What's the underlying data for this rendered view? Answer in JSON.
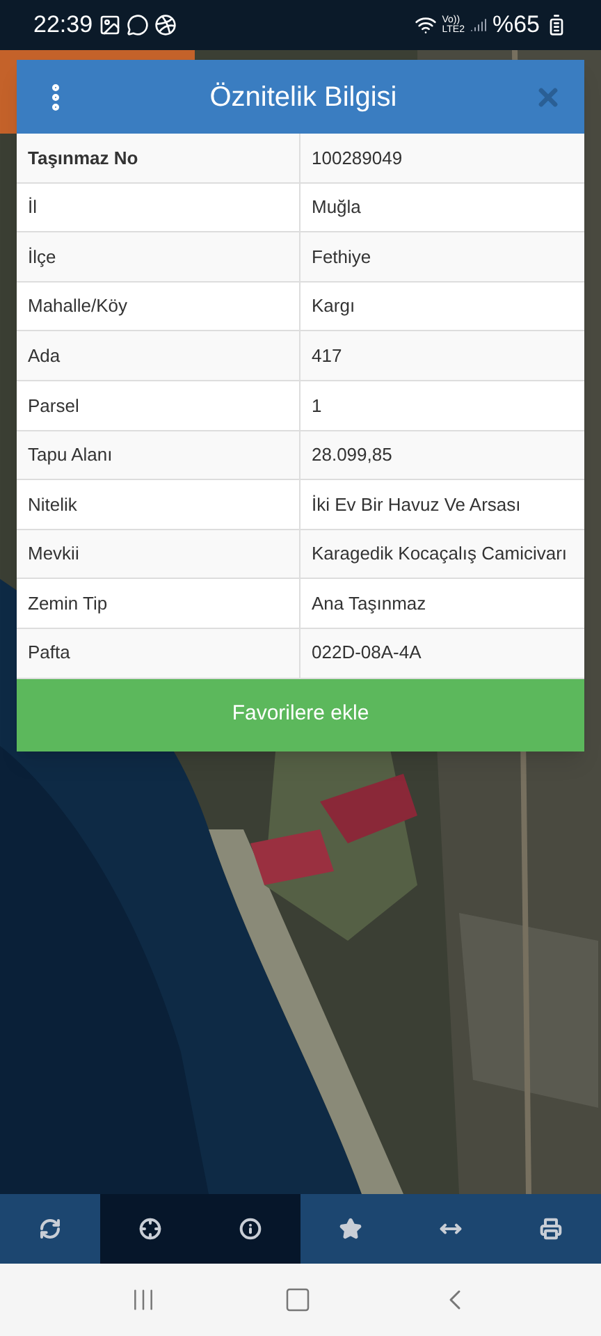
{
  "status_bar": {
    "time": "22:39",
    "network_top": "Vo))",
    "network_bottom": "LTE2",
    "battery": "%65"
  },
  "dialog": {
    "title": "Öznitelik Bilgisi",
    "rows": [
      {
        "label": "Taşınmaz No",
        "value": "100289049",
        "bold": true
      },
      {
        "label": "İl",
        "value": "Muğla",
        "bold": false
      },
      {
        "label": "İlçe",
        "value": "Fethiye",
        "bold": false
      },
      {
        "label": "Mahalle/Köy",
        "value": "Kargı",
        "bold": false
      },
      {
        "label": "Ada",
        "value": "417",
        "bold": false
      },
      {
        "label": "Parsel",
        "value": "1",
        "bold": false
      },
      {
        "label": "Tapu Alanı",
        "value": "28.099,85",
        "bold": false
      },
      {
        "label": "Nitelik",
        "value": "İki Ev Bir Havuz Ve Arsası",
        "bold": false
      },
      {
        "label": "Mevkii",
        "value": "Karagedik Kocaçalış Camicivarı",
        "bold": false
      },
      {
        "label": "Zemin Tip",
        "value": "Ana Taşınmaz",
        "bold": false
      },
      {
        "label": "Pafta",
        "value": "022D-08A-4A",
        "bold": false
      }
    ],
    "button": "Favorilere ekle"
  },
  "toolbar": [
    {
      "kind": "refresh",
      "selected": false
    },
    {
      "kind": "locate",
      "selected": true
    },
    {
      "kind": "info",
      "selected": true
    },
    {
      "kind": "star",
      "selected": false
    },
    {
      "kind": "measure",
      "selected": false
    },
    {
      "kind": "print",
      "selected": false
    }
  ]
}
